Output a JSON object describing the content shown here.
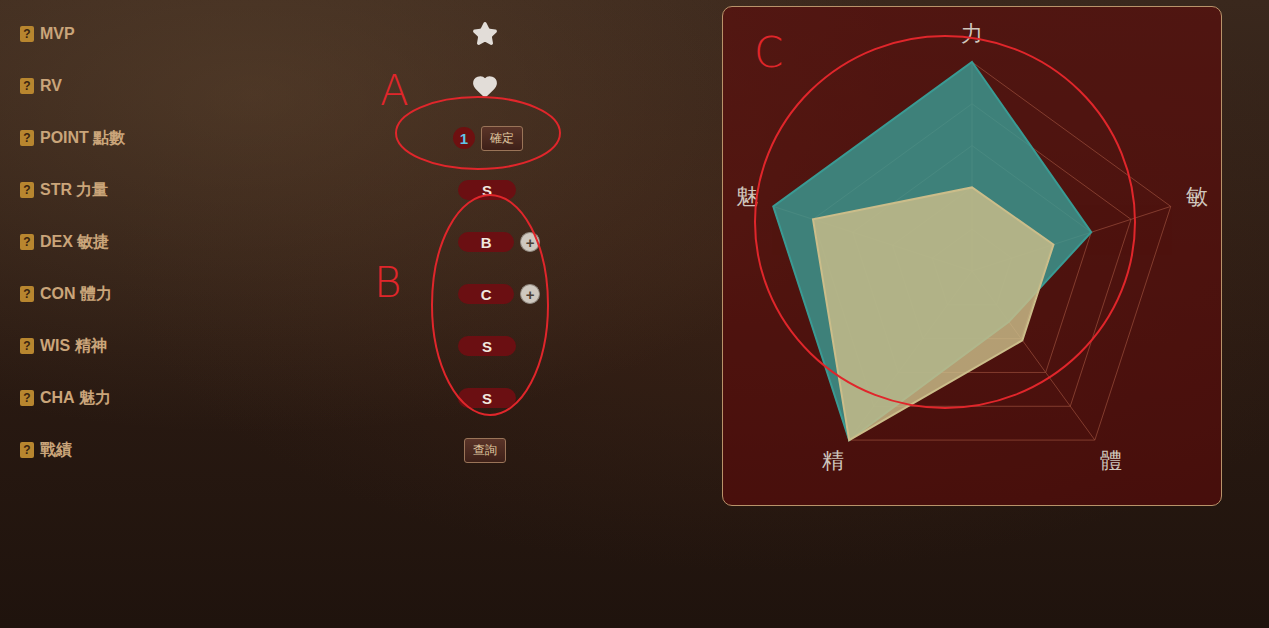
{
  "help_symbol": "?",
  "raise_symbol": "+",
  "rows": [
    {
      "label": "MVP",
      "kind": "star"
    },
    {
      "label": "RV",
      "kind": "heart"
    },
    {
      "label": "POINT 點數",
      "kind": "points",
      "value": "1",
      "button": "確定"
    },
    {
      "label": "STR 力量",
      "kind": "grade",
      "grade": "S",
      "raisable": false
    },
    {
      "label": "DEX 敏捷",
      "kind": "grade",
      "grade": "B",
      "raisable": true
    },
    {
      "label": "CON 體力",
      "kind": "grade",
      "grade": "C",
      "raisable": true
    },
    {
      "label": "WIS 精神",
      "kind": "grade",
      "grade": "S",
      "raisable": false
    },
    {
      "label": "CHA 魅力",
      "kind": "grade",
      "grade": "S",
      "raisable": false
    },
    {
      "label": "戰績",
      "kind": "button",
      "button": "查詢"
    }
  ],
  "chart": {
    "axes": [
      "力",
      "敏",
      "體",
      "精",
      "魅"
    ],
    "max": 100,
    "series": [
      {
        "color": "#3a9a93",
        "values": [
          100,
          60,
          30,
          100,
          100
        ]
      },
      {
        "color": "#cbbd8a",
        "values": [
          40,
          41,
          41,
          100,
          80
        ]
      }
    ]
  },
  "annotations": [
    {
      "label": "A"
    },
    {
      "label": "B"
    },
    {
      "label": "C"
    }
  ]
}
